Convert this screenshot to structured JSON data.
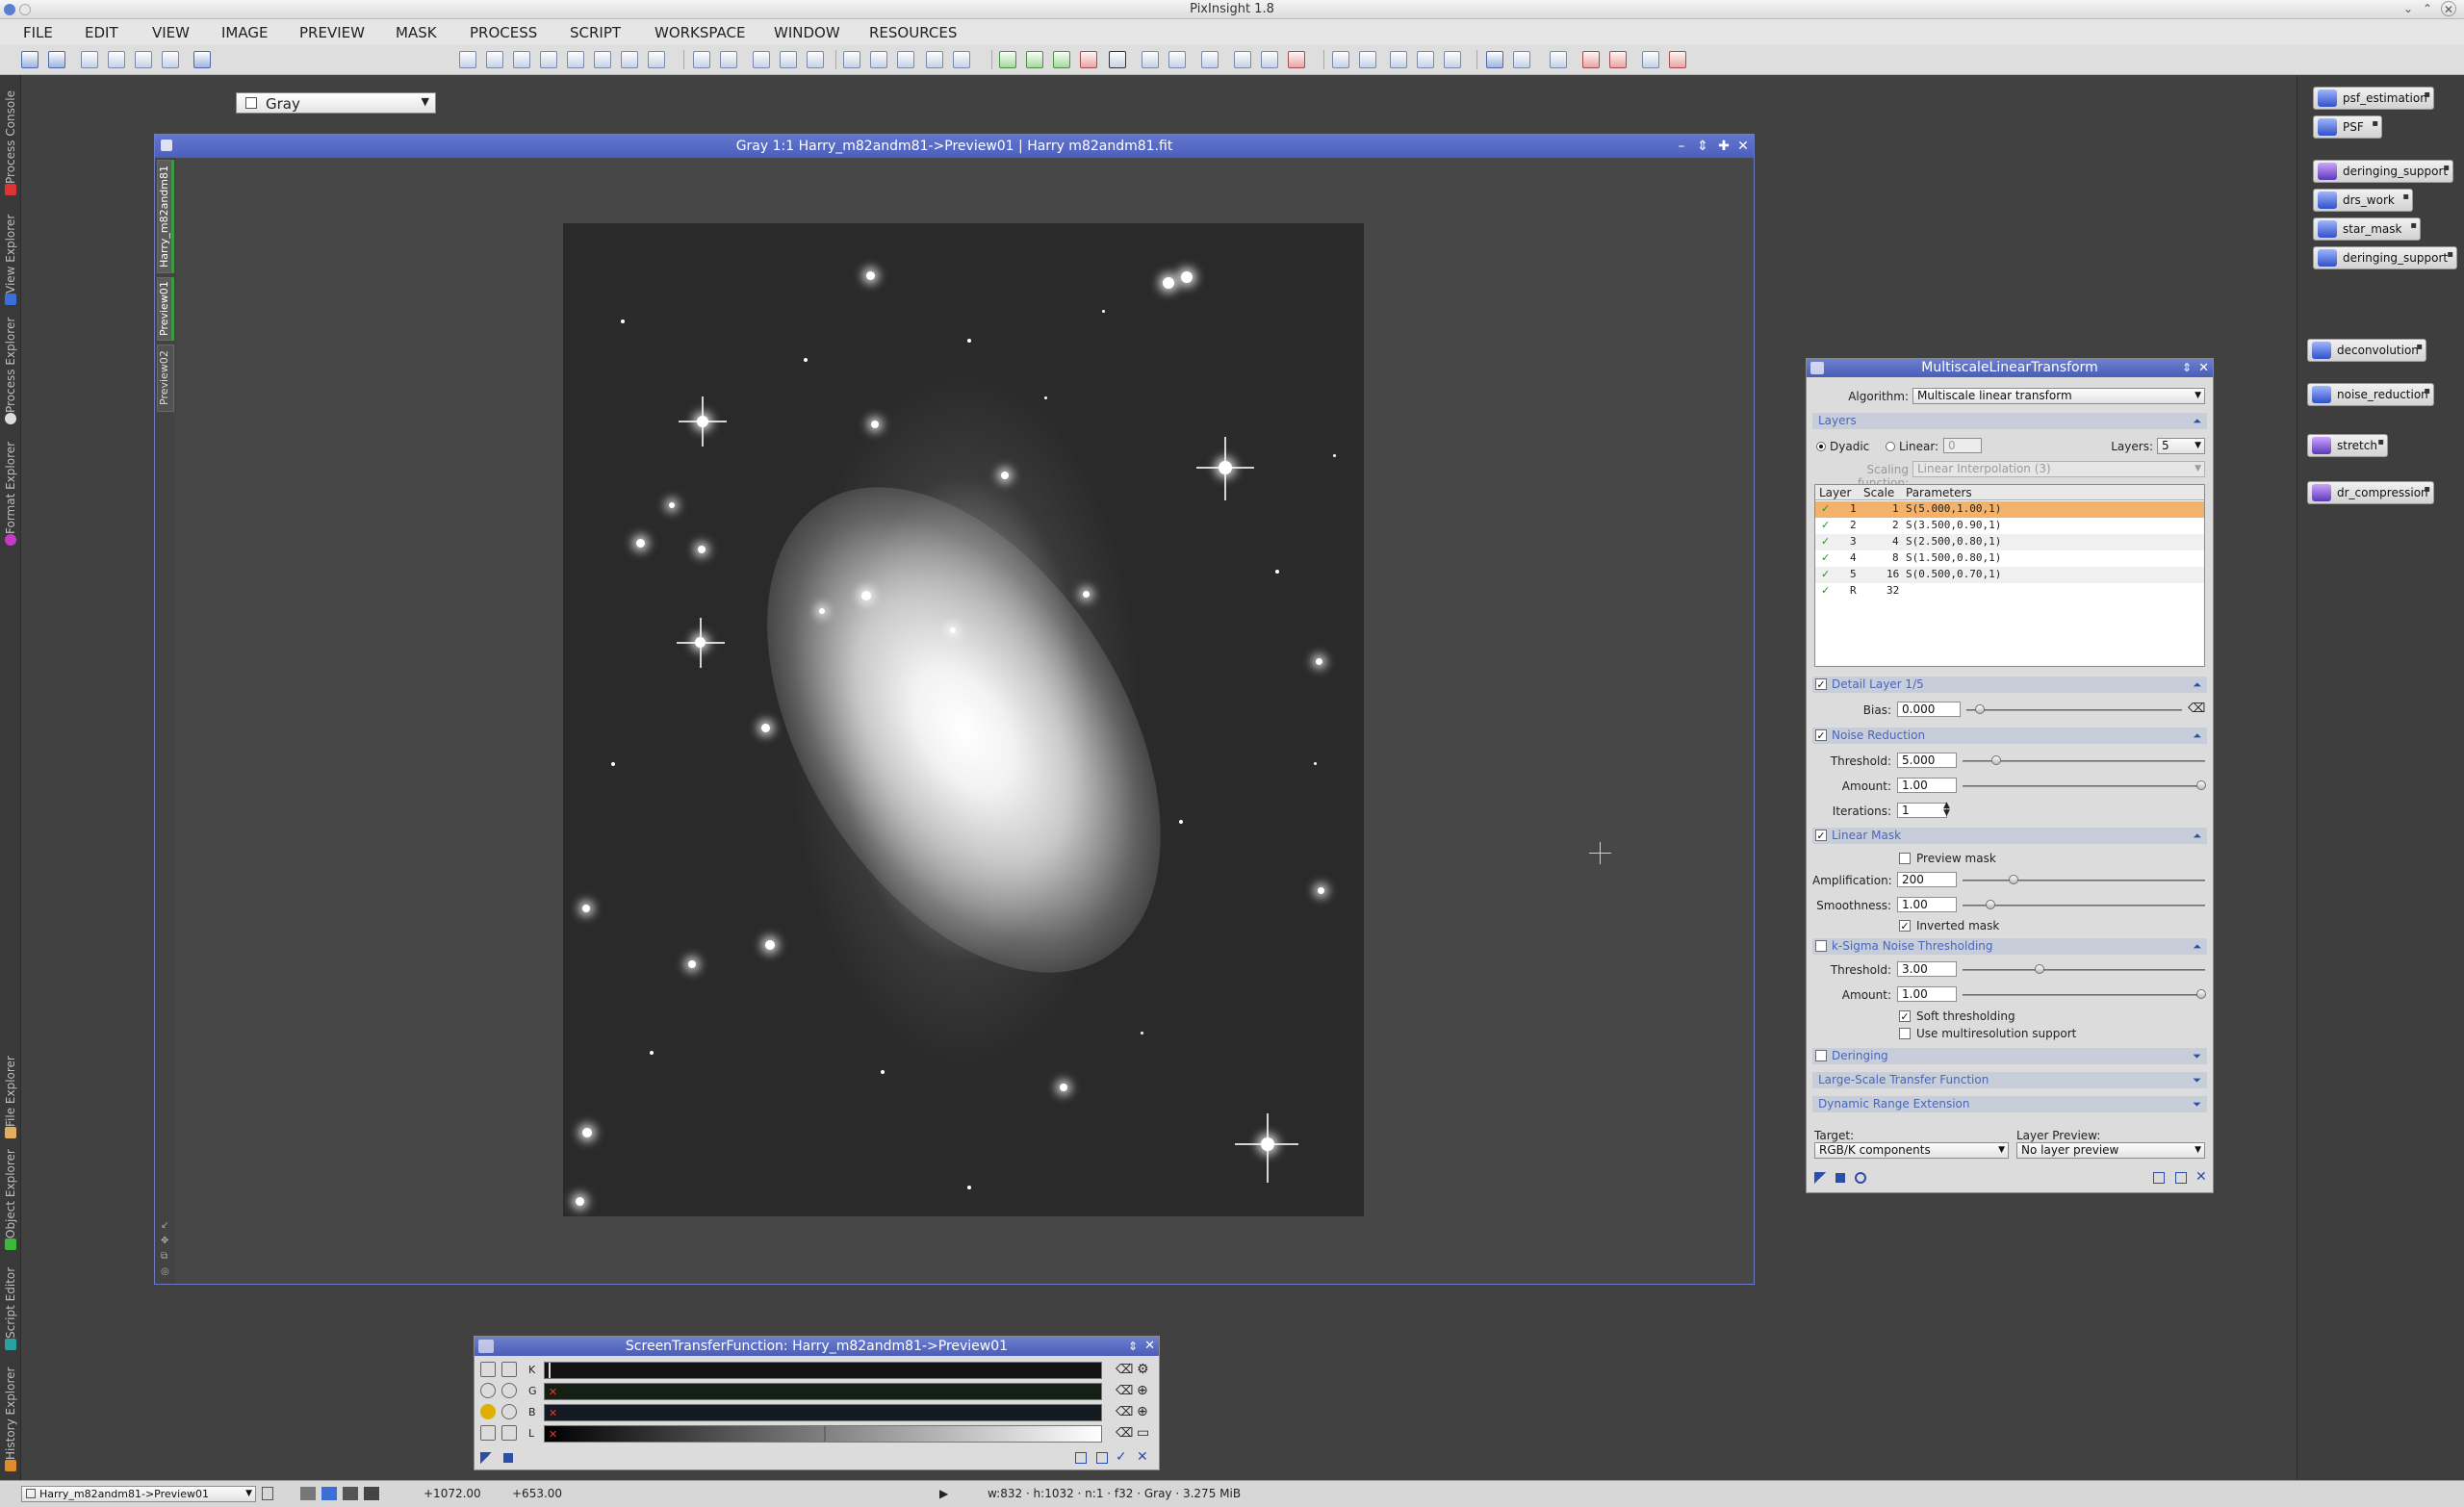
{
  "window": {
    "title": "PixInsight 1.8"
  },
  "menu": [
    "FILE",
    "EDIT",
    "VIEW",
    "IMAGE",
    "PREVIEW",
    "MASK",
    "PROCESS",
    "SCRIPT",
    "WORKSPACE",
    "WINDOW",
    "RESOURCES"
  ],
  "toolbar": {
    "color_space": "Gray"
  },
  "left_tabs": [
    "Process Console",
    "View Explorer",
    "Process Explorer",
    "Format Explorer",
    "File Explorer",
    "Object Explorer",
    "Script Editor",
    "History Explorer"
  ],
  "image_window": {
    "title": "Gray 1:1 Harry_m82andm81->Preview01 | Harry m82andm81.fit",
    "view_tabs": [
      "Harry_m82andm81",
      "Preview01",
      "Preview02"
    ]
  },
  "process_icons": [
    "psf_estimation",
    "PSF",
    "deringing_support",
    "drs_work",
    "star_mask",
    "deringing_support",
    "deconvolution",
    "noise_reduction",
    "stretch",
    "dr_compression"
  ],
  "mlt": {
    "title": "MultiscaleLinearTransform",
    "algorithm_label": "Algorithm:",
    "algorithm": "Multiscale linear transform",
    "layers_section": "Layers",
    "dyadic": "Dyadic",
    "linear": "Linear:",
    "linear_value": "0",
    "layers_label": "Layers:",
    "layers_value": "5",
    "scaling_label": "Scaling function:",
    "scaling_value": "Linear Interpolation (3)",
    "table_headers": [
      "Layer",
      "Scale",
      "Parameters"
    ],
    "rows": [
      {
        "layer": "1",
        "scale": "1",
        "params": "S(5.000,1.00,1)"
      },
      {
        "layer": "2",
        "scale": "2",
        "params": "S(3.500,0.90,1)"
      },
      {
        "layer": "3",
        "scale": "4",
        "params": "S(2.500,0.80,1)"
      },
      {
        "layer": "4",
        "scale": "8",
        "params": "S(1.500,0.80,1)"
      },
      {
        "layer": "5",
        "scale": "16",
        "params": "S(0.500,0.70,1)"
      },
      {
        "layer": "R",
        "scale": "32",
        "params": ""
      }
    ],
    "detail_section": "Detail Layer 1/5",
    "bias_label": "Bias:",
    "bias_value": "0.000",
    "nr_section": "Noise Reduction",
    "threshold_label": "Threshold:",
    "threshold_value": "5.000",
    "amount_label": "Amount:",
    "amount_value": "1.00",
    "iterations_label": "Iterations:",
    "iterations_value": "1",
    "lm_section": "Linear Mask",
    "preview_mask": "Preview mask",
    "amplification_label": "Amplification:",
    "amplification_value": "200",
    "smoothness_label": "Smoothness:",
    "smoothness_value": "1.00",
    "inverted_mask": "Inverted mask",
    "ks_section": "k-Sigma Noise Thresholding",
    "ks_threshold_label": "Threshold:",
    "ks_threshold_value": "3.00",
    "ks_amount_label": "Amount:",
    "ks_amount_value": "1.00",
    "soft_thresholding": "Soft thresholding",
    "multires": "Use multiresolution support",
    "deringing_section": "Deringing",
    "lstf_section": "Large-Scale Transfer Function",
    "dre_section": "Dynamic Range Extension",
    "target_label": "Target:",
    "target_value": "RGB/K components",
    "layer_preview_label": "Layer Preview:",
    "layer_preview_value": "No layer preview"
  },
  "stf": {
    "title": "ScreenTransferFunction: Harry_m82andm81->Preview01",
    "channels": [
      "K",
      "G",
      "B",
      "L"
    ]
  },
  "status": {
    "view": "Harry_m82andm81->Preview01",
    "x": "+1072.00",
    "y": "+653.00",
    "info": "w:832 · h:1032 · n:1 · f32 · Gray · 3.275 MiB"
  }
}
